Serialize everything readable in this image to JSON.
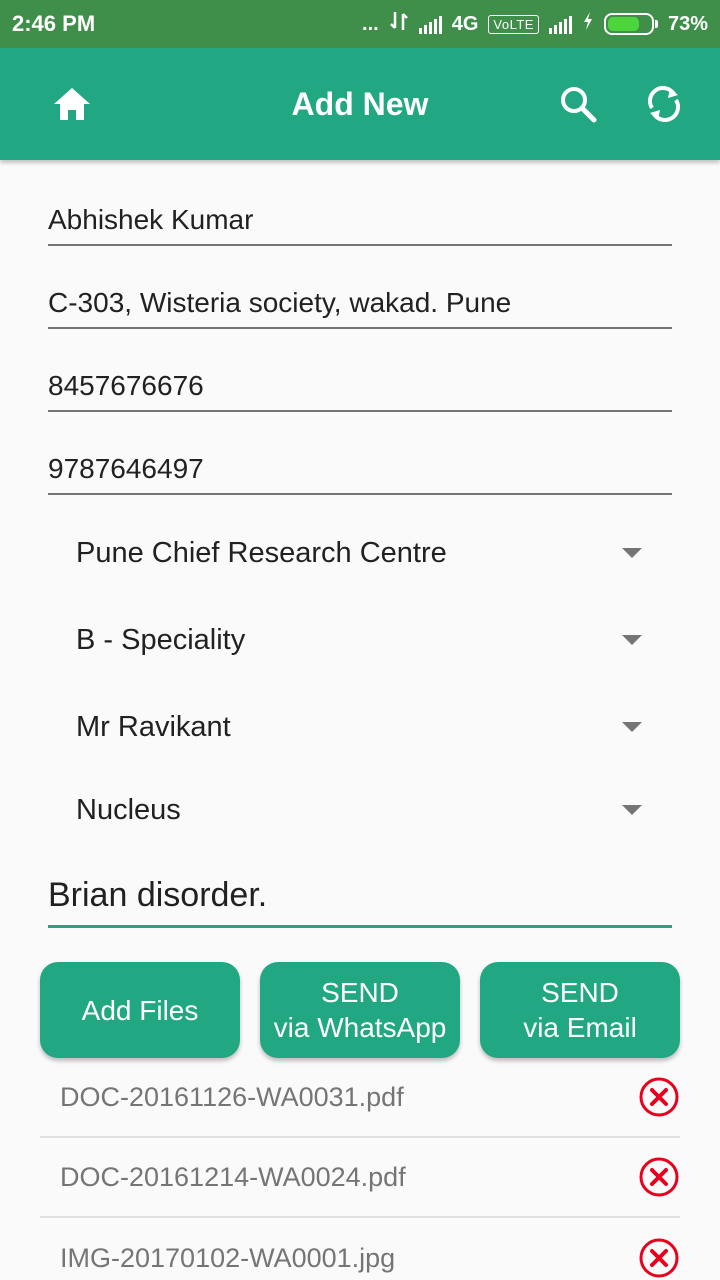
{
  "status_bar": {
    "time": "2:46 PM",
    "dots": "...",
    "network": "4G",
    "volte": "VoLTE",
    "battery_percent": "73%",
    "battery_level": 0.73
  },
  "app_bar": {
    "title": "Add New",
    "icons": [
      "home-icon",
      "search-icon",
      "refresh-icon"
    ],
    "color": "#21a882"
  },
  "form": {
    "name": "Abhishek Kumar",
    "address": "C-303, Wisteria society, wakad. Pune",
    "phone1": "8457676676",
    "phone2": "9787646497",
    "centre": "Pune Chief Research Centre",
    "speciality": "B - Speciality",
    "doctor": "Mr Ravikant",
    "hospital": "Nucleus",
    "notes": "Brian disorder."
  },
  "buttons": {
    "add_files": "Add Files",
    "whatsapp_line1": "SEND",
    "whatsapp_line2": "via WhatsApp",
    "email_line1": "SEND",
    "email_line2": "via Email"
  },
  "files": [
    {
      "name": "DOC-20161126-WA0031.pdf"
    },
    {
      "name": "DOC-20161214-WA0024.pdf"
    },
    {
      "name": "IMG-20170102-WA0001.jpg"
    }
  ]
}
